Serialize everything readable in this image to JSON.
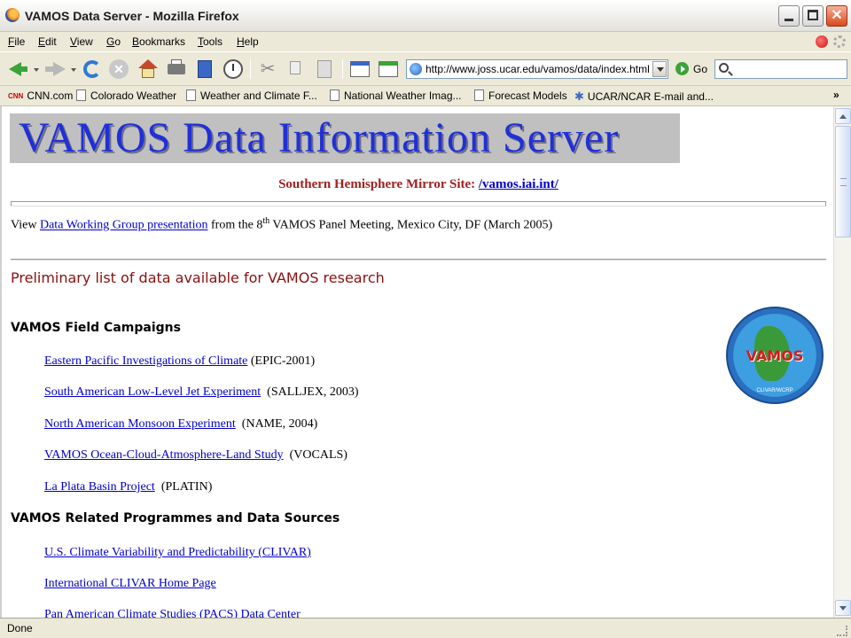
{
  "window": {
    "title": "VAMOS Data Server - Mozilla Firefox"
  },
  "menu": {
    "items": [
      {
        "label": "File",
        "accesskey": "F"
      },
      {
        "label": "Edit",
        "accesskey": "E"
      },
      {
        "label": "View",
        "accesskey": "V"
      },
      {
        "label": "Go",
        "accesskey": "G"
      },
      {
        "label": "Bookmarks",
        "accesskey": "B"
      },
      {
        "label": "Tools",
        "accesskey": "T"
      },
      {
        "label": "Help",
        "accesskey": "H"
      }
    ]
  },
  "navbar": {
    "url": "http://www.joss.ucar.edu/vamos/data/index.html",
    "go_label": "Go",
    "search_placeholder": ""
  },
  "bookmarks": {
    "items": [
      {
        "label": "CNN.com",
        "icon": "cnn-icon"
      },
      {
        "label": "Colorado Weather",
        "icon": "page-icon"
      },
      {
        "label": "Weather and Climate F...",
        "icon": "page-icon"
      },
      {
        "label": "National Weather Imag...",
        "icon": "page-icon"
      },
      {
        "label": "Forecast Models",
        "icon": "page-icon"
      },
      {
        "label": "UCAR/NCAR E-mail and...",
        "icon": "gear-icon"
      }
    ],
    "more_label": "»"
  },
  "page": {
    "banner_text": "VAMOS Data Information Server",
    "mirror_prefix": "Southern Hemisphere Mirror Site: ",
    "mirror_link": "/vamos.iai.int/",
    "view_prefix": "View ",
    "view_link": "Data Working Group presentation",
    "view_mid": " from the 8",
    "view_sup": "th",
    "view_suffix": " VAMOS Panel Meeting, Mexico City, DF (March 2005)",
    "prelim_heading": "Preliminary list of data available for VAMOS research",
    "field_heading": "VAMOS Field Campaigns",
    "field_campaigns": [
      {
        "link": "Eastern Pacific Investigations of Climate",
        "note": " (EPIC-2001)"
      },
      {
        "link": "South American Low-Level Jet Experiment",
        "note": "  (SALLJEX, 2003)"
      },
      {
        "link": "North American Monsoon Experiment",
        "note": "  (NAME, 2004)"
      },
      {
        "link": "VAMOS Ocean-Cloud-Atmosphere-Land Study",
        "note": "  (VOCALS)"
      },
      {
        "link": "La Plata Basin Project",
        "note": "  (PLATIN)"
      }
    ],
    "related_heading": "VAMOS Related Programmes and Data Sources",
    "related": [
      {
        "link": "U.S. Climate Variability and Predictability (CLIVAR)"
      },
      {
        "link": "International CLIVAR Home Page"
      },
      {
        "link": "Pan American Climate Studies (PACS) Data Center"
      }
    ],
    "logo": {
      "text": "VAMOS",
      "sub": "CLIVAR/WCRP"
    }
  },
  "status": {
    "text": "Done"
  },
  "colors": {
    "banner_text": "#1f30d8",
    "mirror_text": "#a02020",
    "prelim_text": "#8b1010",
    "link": "#0000cc"
  }
}
